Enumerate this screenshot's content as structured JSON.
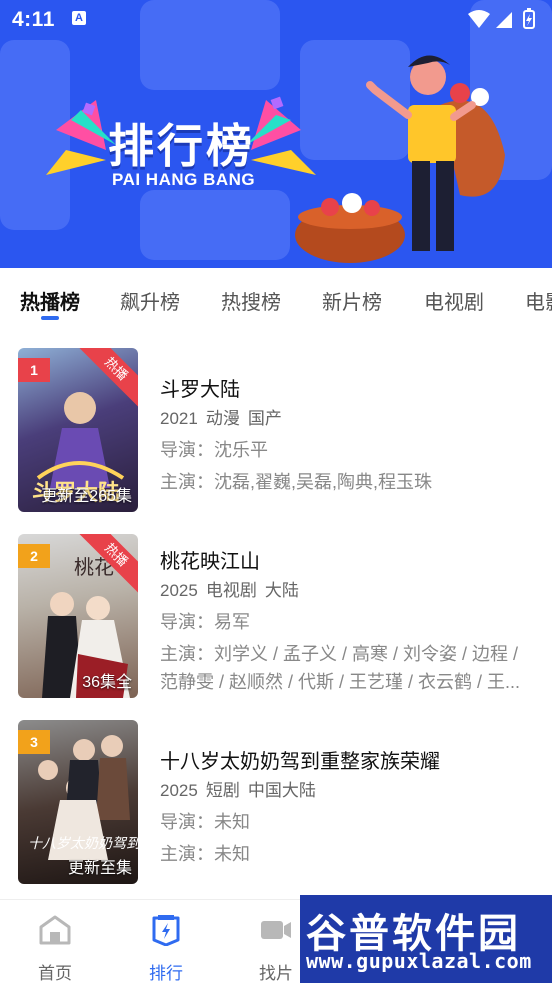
{
  "status": {
    "time": "4:11"
  },
  "banner": {
    "title": "排行榜",
    "subtitle": "PAI HANG BANG"
  },
  "tabs": [
    {
      "label": "热播榜",
      "active": true
    },
    {
      "label": "飙升榜"
    },
    {
      "label": "热搜榜"
    },
    {
      "label": "新片榜"
    },
    {
      "label": "电视剧"
    },
    {
      "label": "电影"
    }
  ],
  "items": [
    {
      "rank": "1",
      "ribbon": "热播",
      "badge": "更新至265集",
      "title": "斗罗大陆",
      "meta": [
        "2021",
        "动漫",
        "国产"
      ],
      "director": "导演：沈乐平",
      "cast1": "主演：沈磊,翟巍,吴磊,陶典,程玉珠",
      "cast2": ""
    },
    {
      "rank": "2",
      "ribbon": "热播",
      "badge": "36集全",
      "title": "桃花映江山",
      "meta": [
        "2025",
        "电视剧",
        "大陆"
      ],
      "director": "导演：易军",
      "cast1": "主演：刘学义 / 孟子义 / 高寒 / 刘令姿 / 边程 /",
      "cast2": "范静雯 / 赵顺然 / 代斯 / 王艺瑾 / 衣云鹤 / 王..."
    },
    {
      "rank": "3",
      "ribbon": "",
      "badge": "更新至",
      "title": "十八岁太奶奶驾到重整家族荣耀",
      "meta": [
        "2025",
        "短剧",
        "中国大陆"
      ],
      "director": "导演：未知",
      "cast1": "主演：未知",
      "cast2": ""
    }
  ],
  "bottom_nav": [
    {
      "label": "首页",
      "icon": "home-icon"
    },
    {
      "label": "排行",
      "icon": "ranking-icon",
      "active": true
    },
    {
      "label": "找片",
      "icon": "video-camera-icon"
    }
  ],
  "watermark": {
    "cn": "谷普软件园",
    "url": "www.gupuxlazal.com"
  },
  "colors": {
    "accent": "#2f6bf0",
    "banner": "#2b56f0",
    "hot": "#e8424a"
  }
}
